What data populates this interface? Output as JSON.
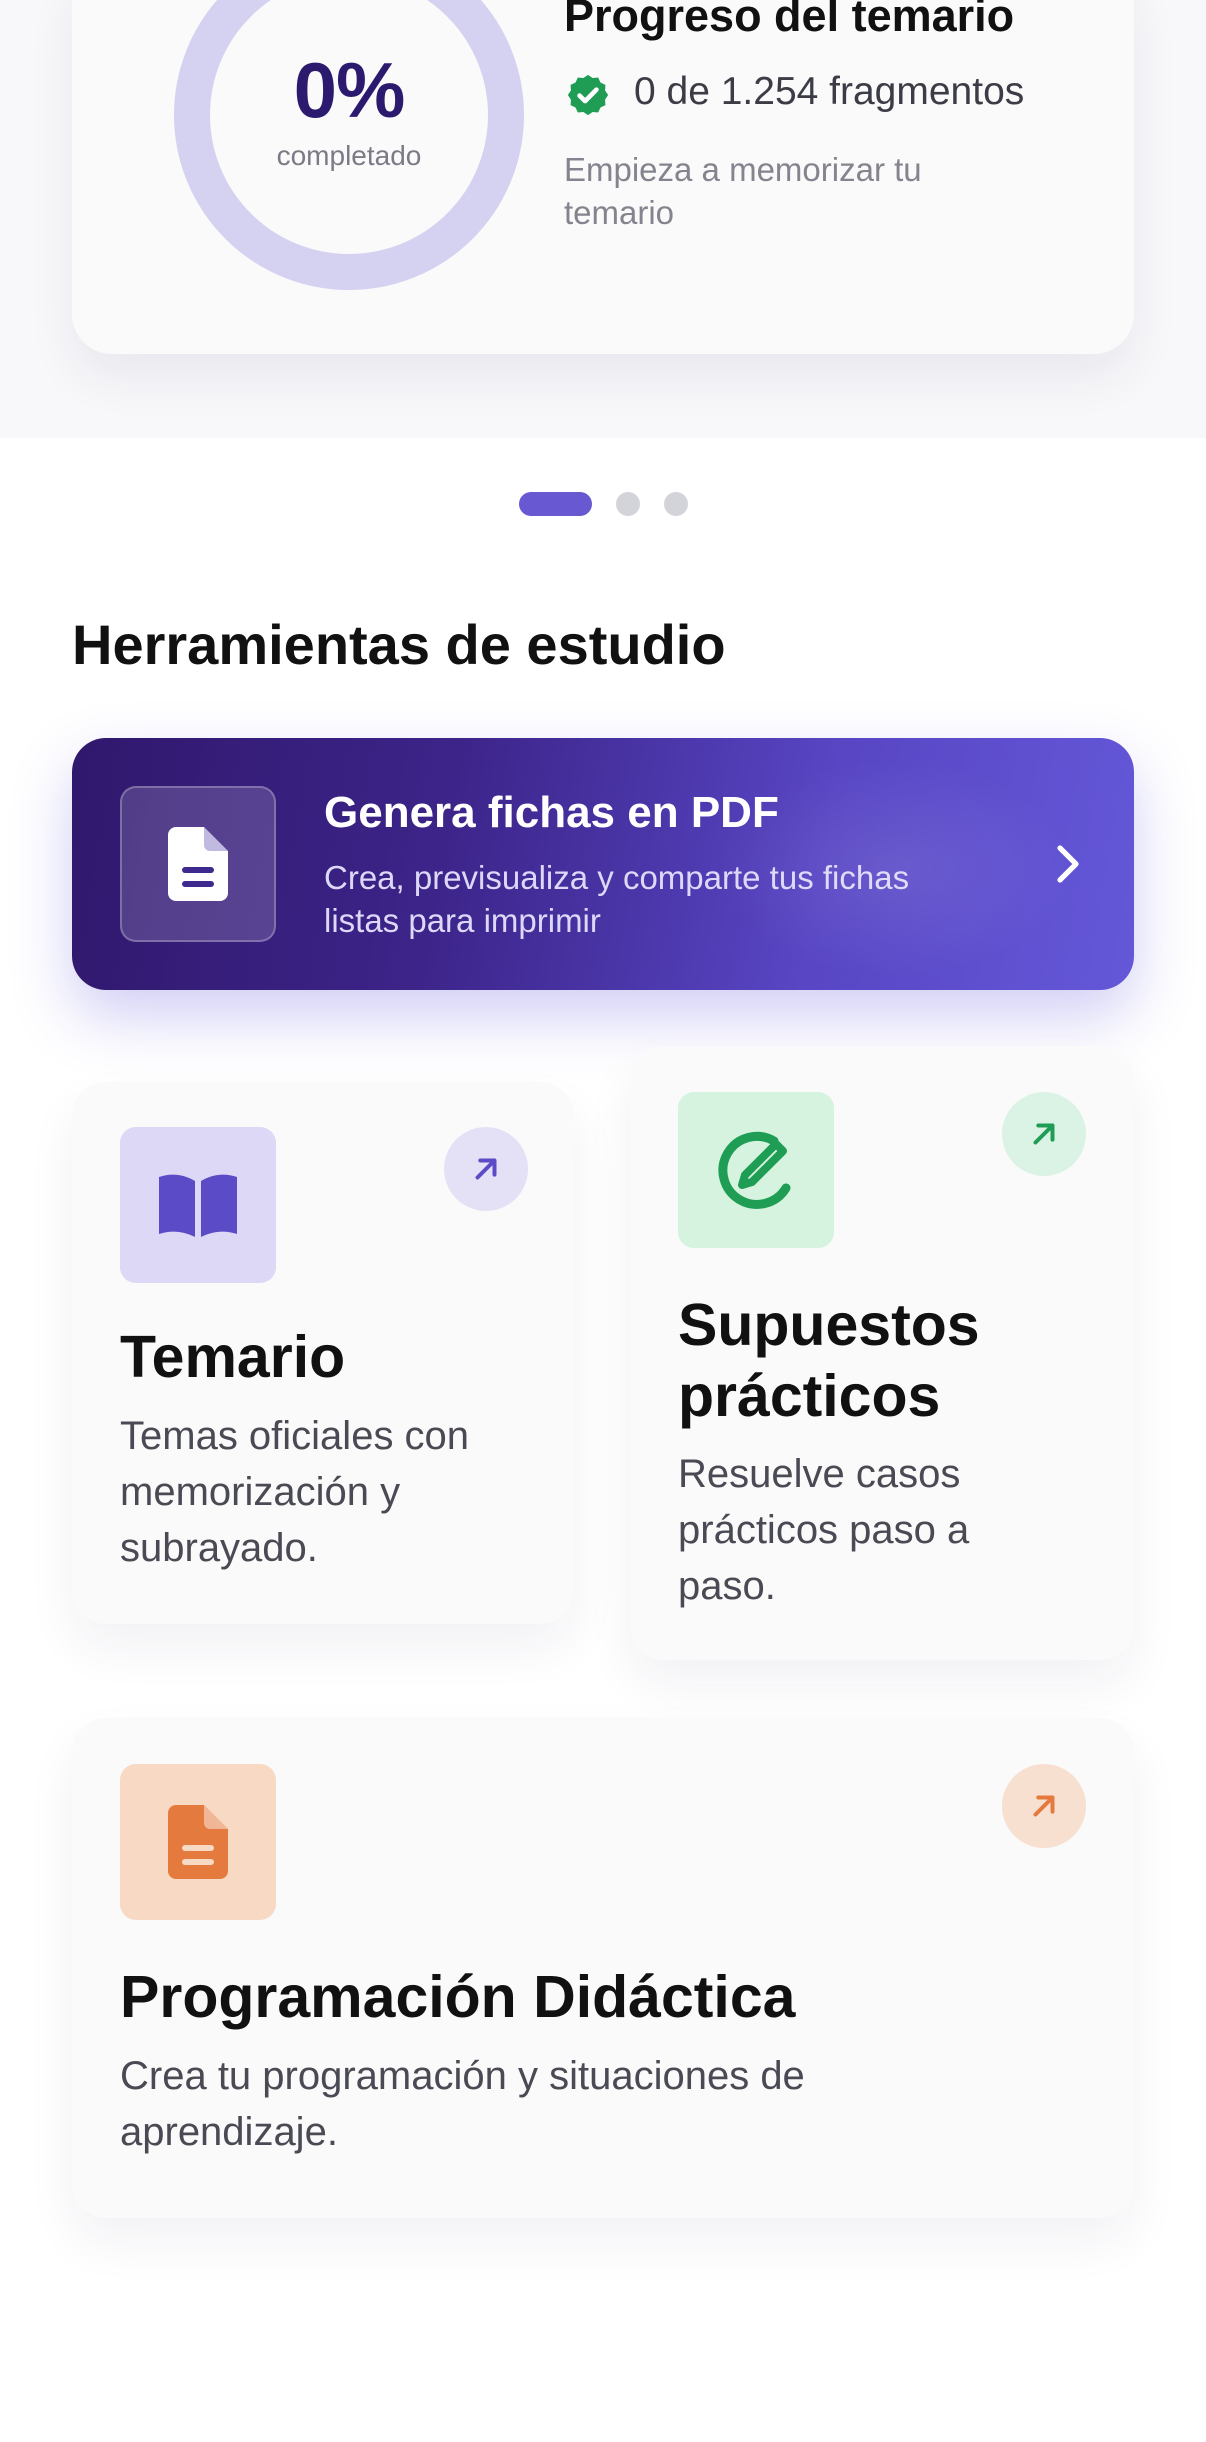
{
  "progress": {
    "percent": "0%",
    "percent_caption": "completado",
    "title": "Progreso del temario",
    "fragments": "0 de 1.254 fragmentos",
    "hint": "Empieza a memorizar tu temario",
    "completed_fraction": 0
  },
  "carousel": {
    "pages": 3,
    "active": 0
  },
  "tools": {
    "section_title": "Herramientas de estudio",
    "pdf": {
      "title": "Genera fichas en PDF",
      "subtitle": "Crea, previsualiza y comparte tus fichas listas para imprimir"
    },
    "temario": {
      "title": "Temario",
      "description": "Temas oficiales con memorización y subrayado."
    },
    "supuestos": {
      "title": "Supuestos prácticos",
      "description": "Resuelve casos prácticos paso a paso."
    },
    "programacion": {
      "title": "Programación Didáctica",
      "description": "Crea tu programación y situaciones de aprendizaje."
    }
  },
  "colors": {
    "accent": "#6859d3",
    "ring": "#d5d1f1",
    "percent_text": "#2c1a6e",
    "success": "#1f9d55",
    "temario_bg": "#dcd8f6",
    "supuestos_bg": "#d5f3df",
    "programacion_bg": "#f8d9c4"
  },
  "icons": {
    "check": "verified-badge-icon",
    "pdf": "document-icon",
    "chevron": "chevron-right-icon",
    "temario": "book-open-icon",
    "supuestos": "edit-circle-icon",
    "programacion": "document-icon",
    "arrow": "arrow-up-right-icon"
  }
}
